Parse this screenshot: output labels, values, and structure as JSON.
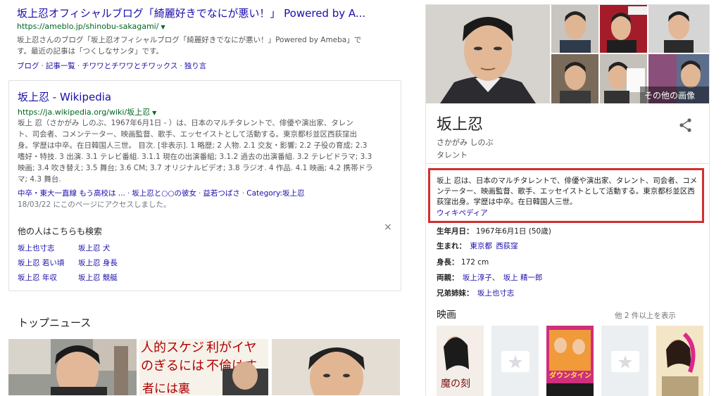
{
  "results": [
    {
      "title": "坂上忍オフィシャルブログ「綺麗好きでなにが悪い！」 Powered by A...",
      "url": "https://ameblo.jp/shinobu-sakagami/",
      "snippet": [
        "坂上忍さんのブログ「坂上忍オフィシャルブログ「綺麗好きでなにが悪い！」Powered by Ameba」で",
        "す。最近の記事は「つくしなサンタ」です。"
      ],
      "links": [
        "ブログ",
        "記事一覧",
        "チワワとチワワとチワックス",
        "独り言"
      ]
    },
    {
      "title": "坂上忍 - Wikipedia",
      "url": "https://ja.wikipedia.org/wiki/坂上忍",
      "snippet": [
        "坂上 忍（さかがみ しのぶ、1967年6月1日 - ）は、日本のマルチタレントで、俳優や演出家、タレン",
        "ト、司会者、コメンテーター、映画監督、歌手、エッセイストとして活動する。東京都杉並区西荻窪出",
        "身。学歴は中卒。在日韓国人三世。 目次. [非表示]. 1 略歴; 2 人物. 2.1 交友・影響; 2.2 子役の育成; 2.3",
        "嗜好・特技. 3 出演. 3.1 テレビ番組. 3.1.1 現在の出演番組; 3.1.2 過去の出演番組. 3.2 テレビドラマ; 3.3",
        "映画; 3.4 吹き替え; 3.5 舞台; 3.6 CM; 3.7 オリジナルビデオ; 3.8 ラジオ. 4 作品. 4.1 映画; 4.2 携帯ドラ",
        "マ; 4.3 舞台."
      ],
      "links": [
        "中卒・東大一直線 もう高校は ...",
        "坂上忍と○○の彼女",
        "益若つばさ",
        "Category:坂上忍"
      ],
      "visited": "18/03/22 にこのページにアクセスしました。"
    }
  ],
  "also_searched": {
    "title": "他の人はこちらも検索",
    "close": "×",
    "items": [
      "坂上也寸志",
      "坂上忍 犬",
      "坂上忍 若い頃",
      "坂上忍 身長",
      "坂上忍 年収",
      "坂上忍 競艇"
    ]
  },
  "top_news": {
    "title": "トップニュース",
    "overlay_text": "者には裏"
  },
  "knowledge_panel": {
    "more_images": "その他の画像",
    "name": "坂上忍",
    "reading": "さかがみ しのぶ",
    "category": "タレント",
    "description": "坂上 忍は、日本のマルチタレントで、俳優や演出家、タレント、司会者、コメンテーター、映画監督、歌手、エッセイストとして活動する。東京都杉並区西荻窪出身。学歴は中卒。在日韓国人三世。",
    "source": "ウィキペディア",
    "facts": [
      {
        "label": "生年月日",
        "value": "1967年6月1日 (50歳)",
        "links": []
      },
      {
        "label": "生まれ",
        "value": "",
        "links": [
          "東京都",
          "西荻窪"
        ]
      },
      {
        "label": "身長",
        "value": "172 cm",
        "links": []
      },
      {
        "label": "両親",
        "value": "",
        "links": [
          "坂上淳子",
          "坂上 精一郎"
        ]
      },
      {
        "label": "兄弟姉妹",
        "value": "",
        "links": [
          "坂上也寸志"
        ]
      }
    ],
    "movies": {
      "title": "映画",
      "more": "他 2 件以上を表示",
      "poster_texts": [
        "魔の刻",
        "ダウンタイン"
      ]
    },
    "colors": {
      "highlight": "#d32f2f",
      "link": "#1a0dab",
      "url": "#006621"
    }
  }
}
